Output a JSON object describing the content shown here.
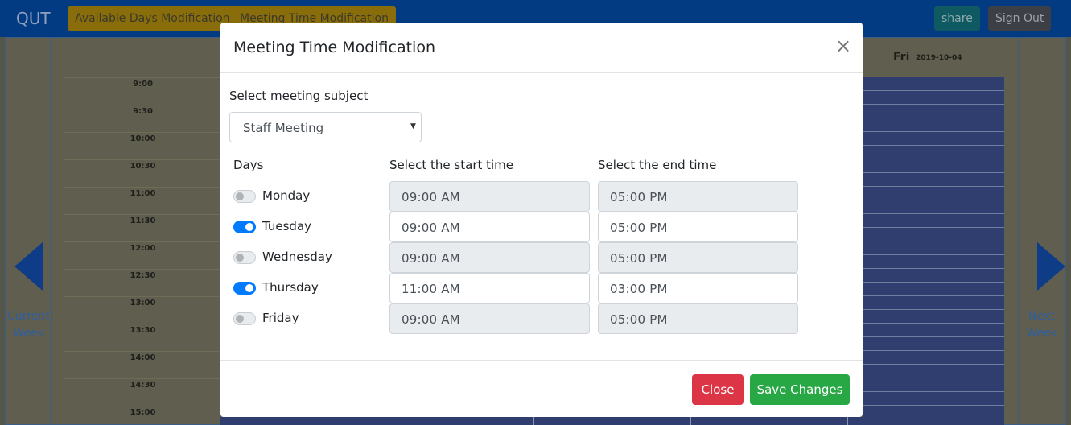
{
  "navbar": {
    "brand": "QUT",
    "available_days_label": "Available Days Modification",
    "meeting_time_label": "Meeting Time Modification",
    "share_label": "share",
    "signout_label": "Sign Out"
  },
  "calendar": {
    "times": [
      "9:00",
      "9:30",
      "10:00",
      "10:30",
      "11:00",
      "11:30",
      "12:00",
      "12:30",
      "13:00",
      "13:30",
      "14:00",
      "14:30",
      "15:00"
    ],
    "friday": {
      "day": "Fri",
      "date": "2019-10-04"
    },
    "prev": {
      "line1": "Current",
      "line2": "Week"
    },
    "next": {
      "line1": "Next",
      "line2": "Week"
    }
  },
  "modal": {
    "title": "Meeting Time Modification",
    "close_symbol": "×",
    "subject_label": "Select meeting subject",
    "subject_value": "Staff Meeting",
    "days_header": "Days",
    "start_header": "Select the start time",
    "end_header": "Select the end time",
    "days": [
      {
        "name": "Monday",
        "enabled": false,
        "start": "09:00  AM",
        "end": "05:00  PM"
      },
      {
        "name": "Tuesday",
        "enabled": true,
        "start": "09:00  AM",
        "end": "05:00  PM"
      },
      {
        "name": "Wednesday",
        "enabled": false,
        "start": "09:00  AM",
        "end": "05:00  PM"
      },
      {
        "name": "Thursday",
        "enabled": true,
        "start": "11:00  AM",
        "end": "03:00  PM"
      },
      {
        "name": "Friday",
        "enabled": false,
        "start": "09:00  AM",
        "end": "05:00  PM"
      }
    ],
    "close_label": "Close",
    "save_label": "Save Changes"
  },
  "colors": {
    "navbar": "#033b82",
    "toggle_on": "#007bff",
    "close_button": "#dc3545",
    "save_button": "#28a745"
  }
}
